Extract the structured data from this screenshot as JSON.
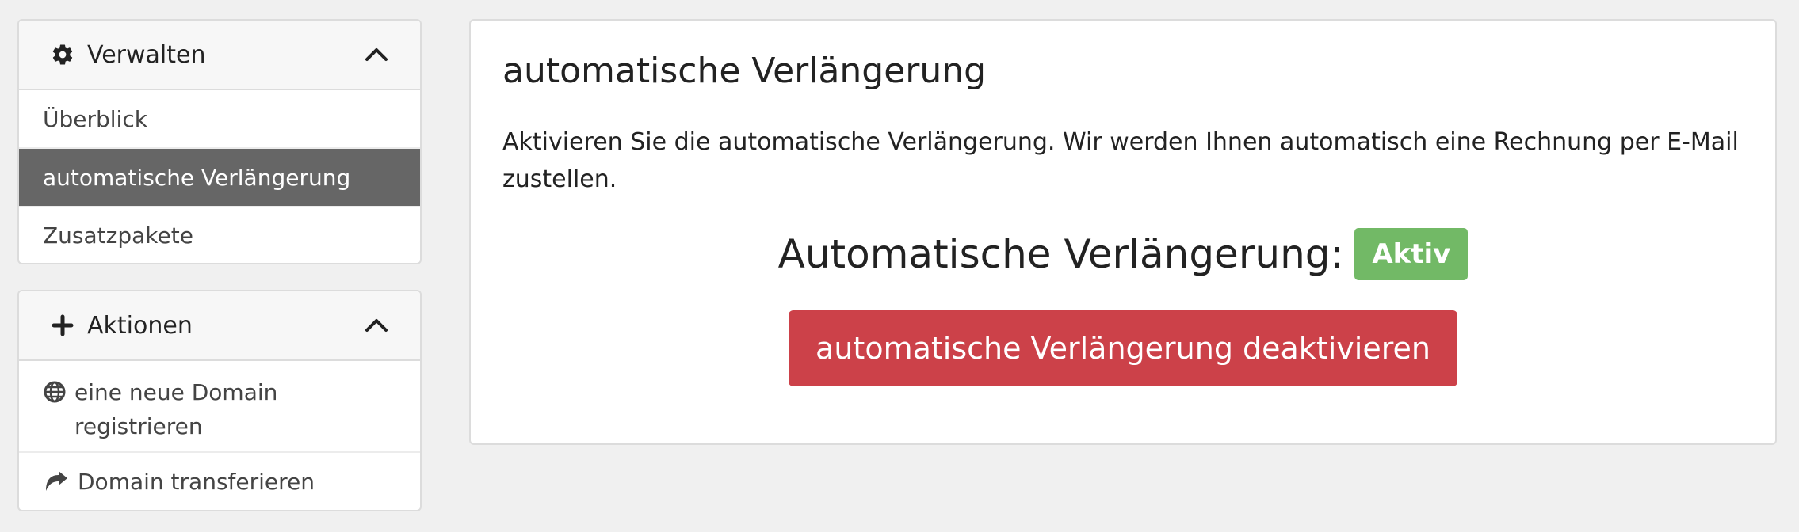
{
  "sidebar": {
    "manage": {
      "title": "Verwalten",
      "items": [
        {
          "label": "Überblick"
        },
        {
          "label": "automatische Verlängerung",
          "active": true
        },
        {
          "label": "Zusatzpakete"
        }
      ]
    },
    "actions": {
      "title": "Aktionen",
      "items": [
        {
          "label": "eine neue Domain registrieren",
          "icon": "globe-icon"
        },
        {
          "label": "Domain transferieren",
          "icon": "share-arrow-icon"
        }
      ]
    }
  },
  "main": {
    "title": "automatische Verlängerung",
    "description": "Aktivieren Sie die automatische Verlängerung. Wir werden Ihnen automatisch eine Rechnung per E-Mail zustellen.",
    "status_label": "Automatische Verlängerung:",
    "status_badge": "Aktiv",
    "button_label": "automatische Verlängerung deaktivieren"
  },
  "colors": {
    "active_item_bg": "#666666",
    "badge_green": "#72b966",
    "danger_red": "#cc4149"
  }
}
